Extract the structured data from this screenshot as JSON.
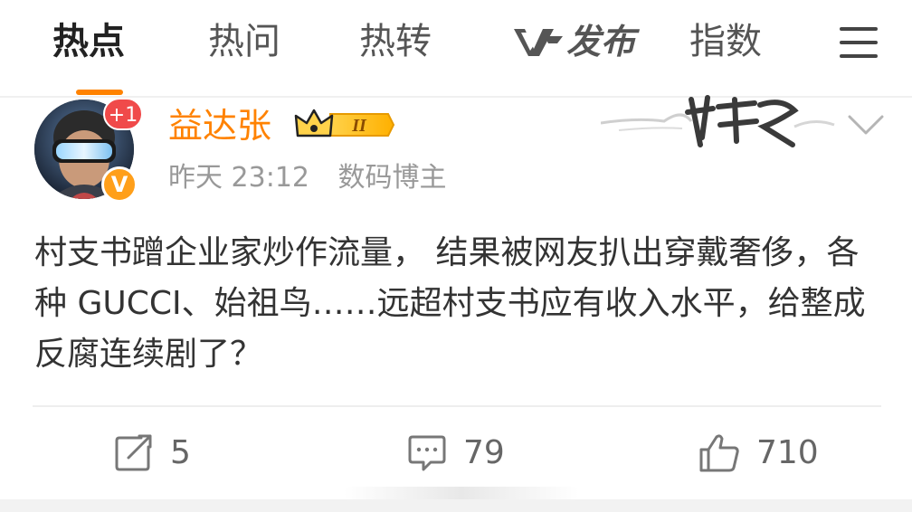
{
  "nav": {
    "tabs": [
      {
        "label": "热点",
        "active": true
      },
      {
        "label": "热问",
        "active": false
      },
      {
        "label": "热转",
        "active": false
      },
      {
        "label": "发布",
        "active": false
      },
      {
        "label": "指数",
        "active": false
      }
    ],
    "menu_icon": "hamburger-menu-icon"
  },
  "post": {
    "avatar_badge": "+1",
    "verified_badge": "V",
    "username": "益达张",
    "member_badge": "II",
    "time": "昨天 23:12",
    "role": "数码博主",
    "text": "村支书蹭企业家炒作流量， 结果被网友扒出穿戴奢侈，各种 GUCCI、始祖鸟……远超村支书应有收入水平，给整成反腐连续剧了？",
    "actions": {
      "repost": "5",
      "comment": "79",
      "like": "710"
    }
  },
  "colors": {
    "accent": "#ff8200",
    "badge_red": "#f04a4a",
    "meta_gray": "#999999",
    "text": "#333333"
  }
}
